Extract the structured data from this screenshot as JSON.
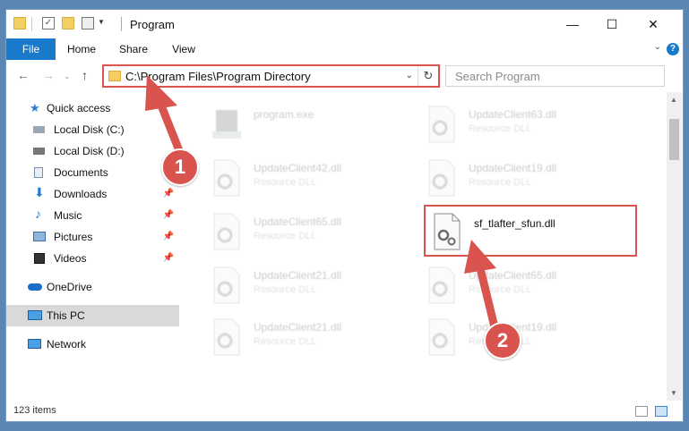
{
  "titlebar": {
    "title": "Program"
  },
  "ribbon": {
    "tabs": [
      "File",
      "Home",
      "Share",
      "View"
    ],
    "help": "?"
  },
  "address": {
    "path": "C:\\Program Files\\Program Directory"
  },
  "search": {
    "placeholder": "Search Program"
  },
  "sidebar": {
    "items": [
      {
        "label": "Quick access"
      },
      {
        "label": "Local Disk (C:)"
      },
      {
        "label": "Local Disk (D:)"
      },
      {
        "label": "Documents"
      },
      {
        "label": "Downloads"
      },
      {
        "label": "Music"
      },
      {
        "label": "Pictures"
      },
      {
        "label": "Videos"
      },
      {
        "label": "OneDrive"
      },
      {
        "label": "This PC"
      },
      {
        "label": "Network"
      }
    ]
  },
  "files": [
    {
      "name": "program.exe",
      "type": ""
    },
    {
      "name": "UpdateClient63.dll",
      "type": "Resource DLL"
    },
    {
      "name": "UpdateClient42.dll",
      "type": "Resource DLL"
    },
    {
      "name": "UpdateClient19.dll",
      "type": "Resource DLL"
    },
    {
      "name": "UpdateClient65.dll",
      "type": "Resource DLL"
    },
    {
      "name": "sf_tlafter_sfun.dll",
      "type": ""
    },
    {
      "name": "UpdateClient21.dll",
      "type": "Resource DLL"
    },
    {
      "name": "UpdateClient65.dll",
      "type": "Resource DLL"
    },
    {
      "name": "UpdateClient21.dll",
      "type": "Resource DLL"
    },
    {
      "name": "UpdateClient19.dll",
      "type": "Resource DLL"
    }
  ],
  "status": {
    "count": "123 items"
  },
  "annotations": {
    "step1": "1",
    "step2": "2"
  },
  "colors": {
    "accent": "#1979ca",
    "highlight": "#d9534f"
  }
}
